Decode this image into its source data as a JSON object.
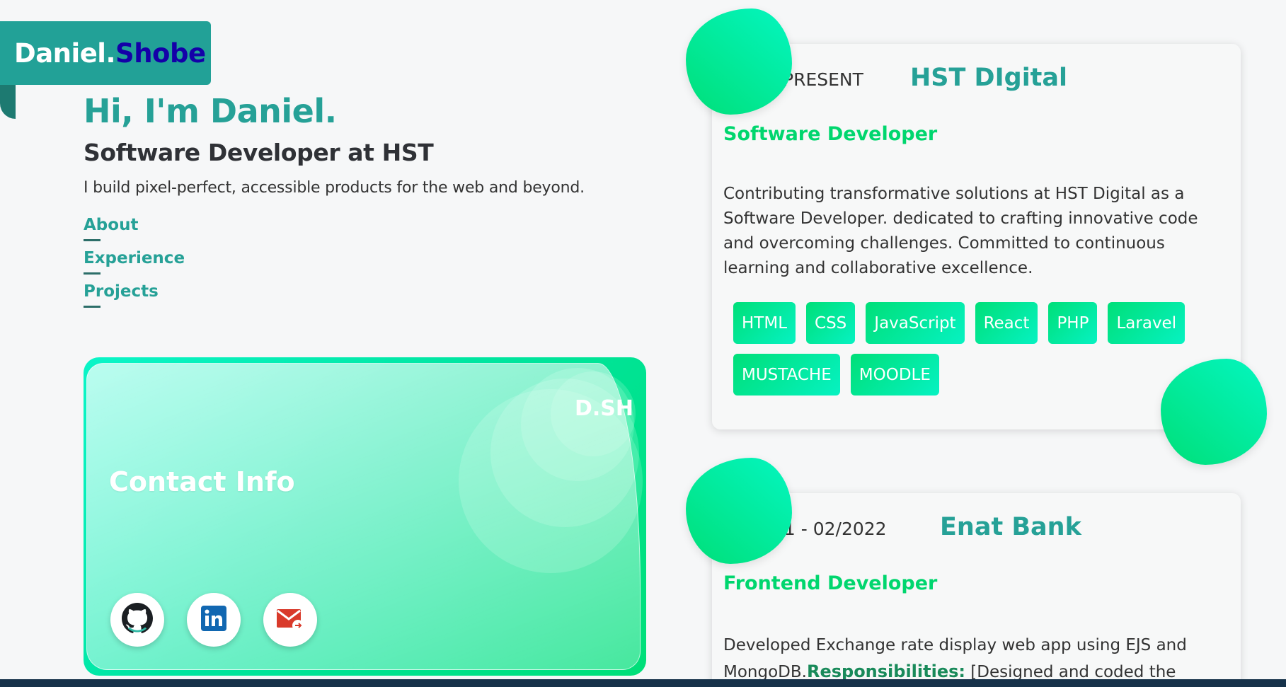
{
  "logo": {
    "first": "Daniel.",
    "last": "Shobe"
  },
  "hero": {
    "title": "Hi, I'm Daniel.",
    "subtitle": "Software Developer at HST",
    "description": "I build pixel-perfect, accessible products for the web and beyond."
  },
  "nav": {
    "items": [
      "About",
      "Experience",
      "Projects"
    ]
  },
  "contact": {
    "badge": "D.SH",
    "title": "Contact Info",
    "socials": [
      {
        "icon": "github-icon"
      },
      {
        "icon": "linkedin-icon"
      },
      {
        "icon": "gmail-icon"
      }
    ]
  },
  "experience": [
    {
      "period": "PRESENT",
      "company": "HST DIgital",
      "role": "Software Developer",
      "description": "Contributing transformative solutions at HST Digital as a Software Developer. dedicated to crafting innovative code and overcoming challenges. Committed to continuous learning and collaborative excellence.",
      "tags": [
        "HTML",
        "CSS",
        "JavaScript",
        "React",
        "PHP",
        "Laravel",
        "MUSTACHE",
        "MOODLE"
      ]
    },
    {
      "period": "21 - 02/2022",
      "company": "Enat Bank",
      "role": "Frontend Developer",
      "description": "Developed Exchange rate display web app using EJS and MongoDB.",
      "responsibilities_label": "Responsibilities:",
      "responsibilities_text": " [Designed and coded the"
    }
  ],
  "colors": {
    "accent": "#26a197",
    "green": "#00df78",
    "teal": "#06f2c2",
    "logo_last": "#1400a8"
  }
}
